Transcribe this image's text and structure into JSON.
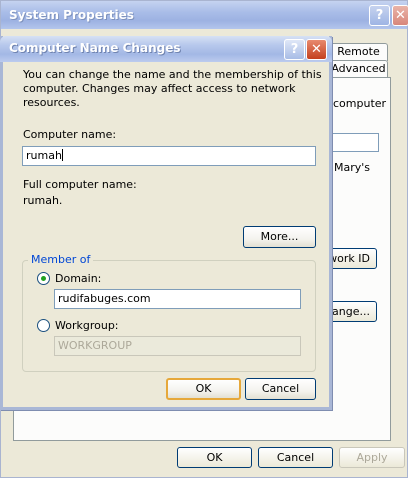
{
  "system_properties": {
    "title": "System Properties",
    "help_glyph": "?",
    "close_glyph": "✕",
    "tabs": [
      {
        "label": "Remote"
      },
      {
        "label": "Advanced"
      }
    ],
    "fragments": {
      "computer": "computer",
      "marys": "Mary's"
    },
    "buttons": {
      "network_id": "twork ID",
      "change": "hange...",
      "ok": "OK",
      "cancel": "Cancel",
      "apply": "Apply"
    }
  },
  "dialog": {
    "title": "Computer Name Changes",
    "help_glyph": "?",
    "close_glyph": "✕",
    "intro": "You can change the name and the membership of this computer. Changes may affect access to network resources.",
    "computer_name_label": "Computer name:",
    "computer_name_value": "rumah",
    "full_name_label": "Full computer name:",
    "full_name_value": "rumah.",
    "more_button": "More...",
    "member_of": {
      "legend": "Member of",
      "domain_label": "Domain:",
      "domain_value": "rudifabuges.com",
      "domain_selected": true,
      "workgroup_label": "Workgroup:",
      "workgroup_value": "WORKGROUP",
      "workgroup_selected": false
    },
    "ok_button": "OK",
    "cancel_button": "Cancel"
  }
}
